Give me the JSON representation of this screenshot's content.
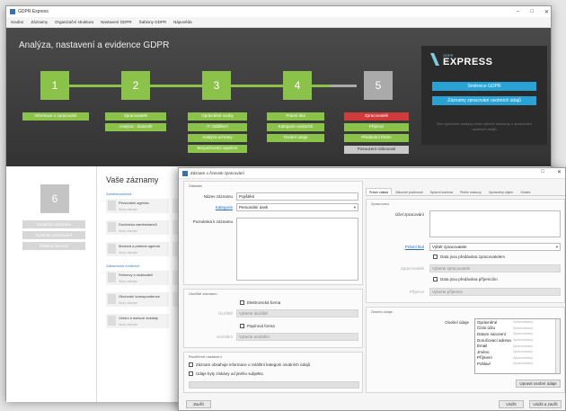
{
  "app": {
    "title": "GDPR Express",
    "controls": [
      "–",
      "□",
      "✕"
    ]
  },
  "menu": [
    "Soubor",
    "Záznamy",
    "Organizační struktura",
    "Nastavení GDPR",
    "Šablony GDPR",
    "Nápověda"
  ],
  "dashboard": {
    "title": "Analýza, nastavení a evidence GDPR",
    "steps": [
      "1",
      "2",
      "3",
      "4",
      "5"
    ],
    "step6": "6",
    "col1": [
      "Informace o zpracování"
    ],
    "col2": [
      "Zpracovatelé",
      "Analýza - dotazník"
    ],
    "col3": [
      "Oprávněné osoby",
      "IT Oddělení",
      "Analýza ochrany",
      "Bezpečnostní opatření"
    ],
    "col4": [
      "Právní titul",
      "Kategorie osobních",
      "Osobní údaje"
    ],
    "col5": [
      "Zpracovatelé",
      "Příjemci",
      "Předávání třetím",
      "Posouzení rizikovosti"
    ],
    "side6": [
      "Evidence záznamu",
      "Kontrola zpracování",
      "Přehled činností"
    ]
  },
  "brand": {
    "small": "GDPR",
    "big": "EXPRESS",
    "btn1": "Směrnice GDPR",
    "btn2": "Záznamy zpracování osobních údajů",
    "note": "Bez vytvořené analýzy nelze vytvořit záznamy o zpracování osobních údajů"
  },
  "records": {
    "title": "Vaše záznamy",
    "cat1": "Zaměstnanecká",
    "cat2": "Zákaznické evidence",
    "items": [
      {
        "t": "Personální agenda",
        "s": "Nový záznam"
      },
      {
        "t": "Docházka zaměstnanců",
        "s": "Nový záznam"
      },
      {
        "t": "Mzdová a platová agenda",
        "s": "Nový záznam"
      },
      {
        "t": "Smlouvy s dodavateli",
        "s": "Nový záznam"
      },
      {
        "t": "Obchodní korespondence",
        "s": "Nový záznam"
      },
      {
        "t": "Účetní a daňové doklady",
        "s": "Nový záznam"
      }
    ]
  },
  "dialog": {
    "title": "Záznam o činnosti zpracování",
    "controls": [
      "–",
      "□",
      "✕"
    ],
    "group_basic": "Základní",
    "name_label": "Název záznamu",
    "name_value": "Pojištění",
    "category_label": "Kategorie",
    "category_value": "Personální úsek",
    "note_label": "Poznámka k záznamu",
    "group_storage": "Úložiště záznamu",
    "electronic": "Elektronická forma",
    "storage_label": "Úložiště",
    "storage_value": "Vyberte úložiště",
    "paper": "Papírová forma",
    "location_label": "Umístění",
    "location_value": "Vyberte umístění",
    "group_extra": "Rozšířené nastavení",
    "extra1": "Záznam obsahuje informace o zvláštní kategorii osobních údajů",
    "extra2": "Údaje byly získány od jiného subjektu",
    "tabs": [
      "Právní základ",
      "Zákonné povinnosti",
      "Správní kontrola",
      "Plnění smlouvy",
      "Oprávněný zájem",
      "Ostatní"
    ],
    "group_process": "Zpracování",
    "purpose_label": "Účel zpracování",
    "processor_label": "Právní titul",
    "processor_value": "Výběr zpracovatele",
    "proc_check1": "Data jsou předávána zpracovatelem",
    "processor2_label": "Zpracovatelé",
    "processor2_value": "Vyberte zpracovatele",
    "proc_check2": "Data jsou předávána příjemcům",
    "recipient_label": "Příjemci",
    "recipient_value": "Vyberte příjemce",
    "group_data": "Osobní údaje",
    "data_label": "Osobní údaje",
    "data_items": [
      "Oprávněné",
      "Číslo účtu",
      "Datum narození",
      "Doručovací adresa",
      "Email",
      "Jméno",
      "Příjmení",
      "Pohlaví"
    ],
    "data_right": "Zpracovávaný",
    "add_btn": "Upravit osobní údaje",
    "footer_left": "Zavřít",
    "footer_save": "Uložit",
    "footer_close": "Uložit a zavřít"
  }
}
